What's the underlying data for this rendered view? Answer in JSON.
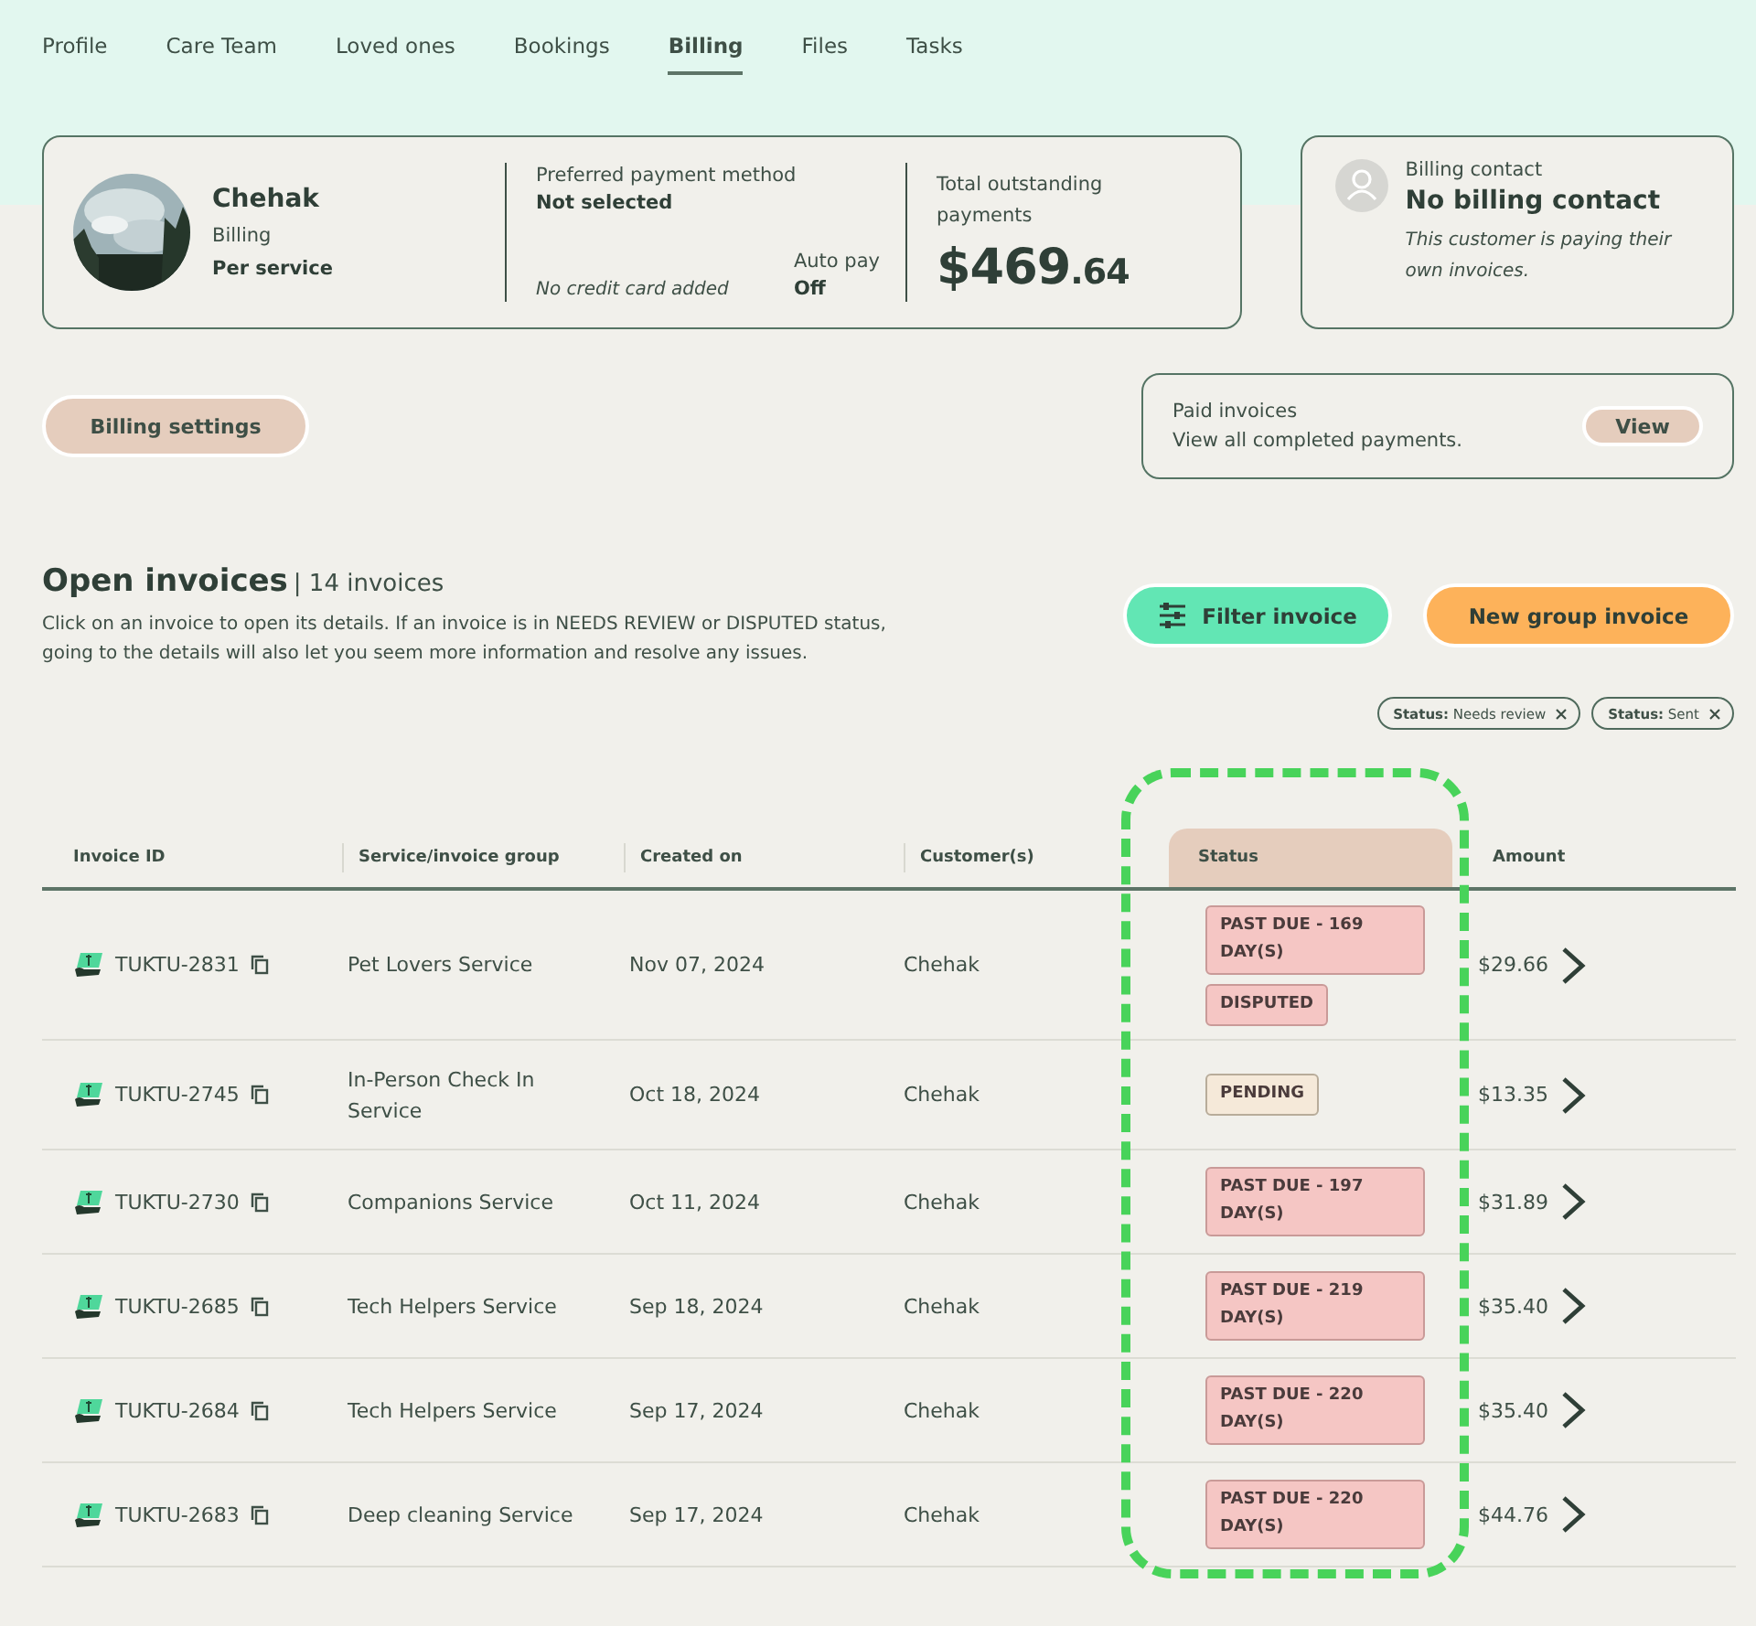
{
  "tabs": [
    {
      "label": "Profile",
      "selected": false
    },
    {
      "label": "Care Team",
      "selected": false
    },
    {
      "label": "Loved ones",
      "selected": false
    },
    {
      "label": "Bookings",
      "selected": false
    },
    {
      "label": "Billing",
      "selected": true
    },
    {
      "label": "Files",
      "selected": false
    },
    {
      "label": "Tasks",
      "selected": false
    }
  ],
  "customer_card": {
    "name": "Chehak",
    "billing_label": "Billing",
    "billing_value": "Per service",
    "payment_method_label": "Preferred payment method",
    "payment_method_value": "Not selected",
    "card_note": "No credit card added",
    "auto_pay_label": "Auto pay",
    "auto_pay_value": "Off",
    "outstanding_label": "Total outstanding payments",
    "outstanding_dollars": "$469",
    "outstanding_cents": ".64"
  },
  "billing_contact": {
    "label": "Billing contact",
    "value": "No billing contact",
    "note": "This customer is paying their own invoices."
  },
  "billing_settings_button": "Billing settings",
  "paid_invoices": {
    "title": "Paid invoices",
    "description": "View all completed payments.",
    "button": "View"
  },
  "open_invoices": {
    "title": "Open invoices",
    "count": "| 14 invoices",
    "description": "Click on an invoice to open its details. If an invoice is in NEEDS REVIEW or DISPUTED status, going to the details will also let you seem more information and resolve any issues."
  },
  "filter_button": "Filter invoice",
  "new_group_invoice_button": "New group invoice",
  "filter_chips": [
    {
      "key": "Status:",
      "value": "Needs review"
    },
    {
      "key": "Status:",
      "value": "Sent"
    }
  ],
  "table": {
    "columns": [
      {
        "label": "Invoice ID",
        "selected": false,
        "outlined": false
      },
      {
        "label": "Service/invoice group",
        "selected": false,
        "outlined": false
      },
      {
        "label": "Created on",
        "selected": false,
        "outlined": false
      },
      {
        "label": "Customer(s)",
        "selected": false,
        "outlined": false
      },
      {
        "label": "Status",
        "selected": true,
        "outlined": true
      },
      {
        "label": "Amount",
        "selected": false,
        "outlined": false
      }
    ],
    "rows": [
      {
        "id": "TUKTU-2831",
        "service": "Pet Lovers Service",
        "created": "Nov 07, 2024",
        "customer": "Chehak",
        "statuses": [
          {
            "kind": "past_due",
            "label": "PAST DUE - 169 DAY(S)"
          },
          {
            "kind": "disputed",
            "label": "DISPUTED"
          }
        ],
        "amount": "$29.66"
      },
      {
        "id": "TUKTU-2745",
        "service": "In-Person Check In Service",
        "created": "Oct 18, 2024",
        "customer": "Chehak",
        "statuses": [
          {
            "kind": "pending",
            "label": "PENDING"
          }
        ],
        "amount": "$13.35"
      },
      {
        "id": "TUKTU-2730",
        "service": "Companions Service",
        "created": "Oct 11, 2024",
        "customer": "Chehak",
        "statuses": [
          {
            "kind": "past_due",
            "label": "PAST DUE - 197 DAY(S)"
          }
        ],
        "amount": "$31.89"
      },
      {
        "id": "TUKTU-2685",
        "service": "Tech Helpers Service",
        "created": "Sep 18, 2024",
        "customer": "Chehak",
        "statuses": [
          {
            "kind": "past_due",
            "label": "PAST DUE - 219 DAY(S)"
          }
        ],
        "amount": "$35.40"
      },
      {
        "id": "TUKTU-2684",
        "service": "Tech Helpers Service",
        "created": "Sep 17, 2024",
        "customer": "Chehak",
        "statuses": [
          {
            "kind": "past_due",
            "label": "PAST DUE - 220 DAY(S)"
          }
        ],
        "amount": "$35.40"
      },
      {
        "id": "TUKTU-2683",
        "service": "Deep cleaning Service",
        "created": "Sep 17, 2024",
        "customer": "Chehak",
        "statuses": [
          {
            "kind": "past_due",
            "label": "PAST DUE - 220 DAY(S)"
          }
        ],
        "amount": "$44.76"
      }
    ]
  }
}
